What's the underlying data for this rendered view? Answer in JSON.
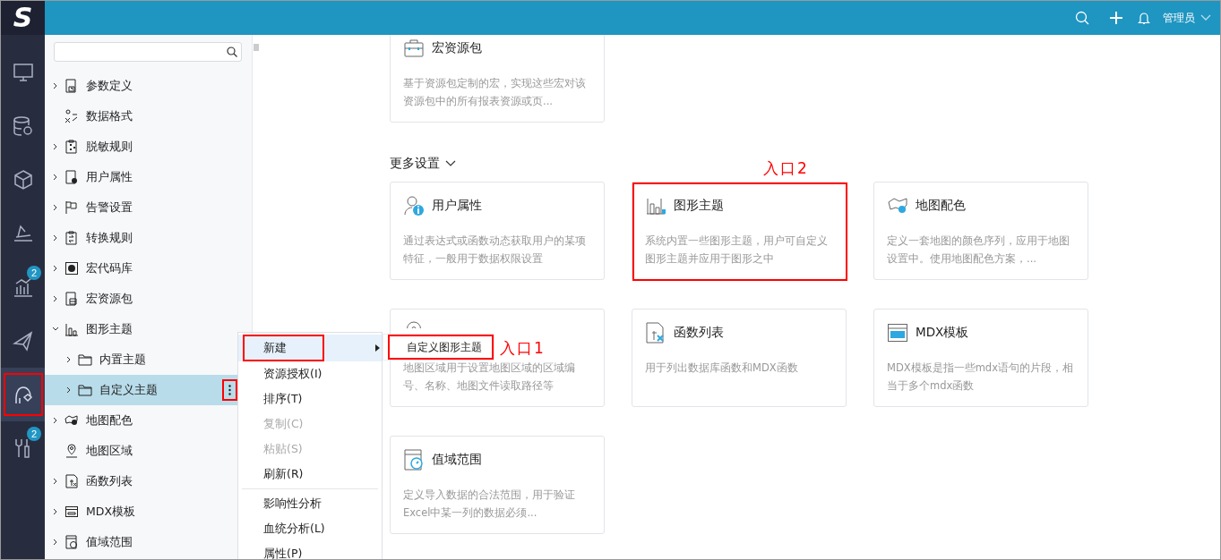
{
  "logo": "S",
  "header": {
    "user": "管理员"
  },
  "rail": [
    {
      "kind": "monitor",
      "selected": false,
      "highlighted": false
    },
    {
      "kind": "database",
      "selected": false,
      "highlighted": false
    },
    {
      "kind": "cube",
      "selected": false,
      "highlighted": false
    },
    {
      "kind": "pen",
      "selected": false,
      "highlighted": false
    },
    {
      "kind": "chart",
      "selected": false,
      "highlighted": false,
      "badge": "2"
    },
    {
      "kind": "plane",
      "selected": false,
      "highlighted": false
    },
    {
      "kind": "theme",
      "selected": true,
      "highlighted": true
    },
    {
      "kind": "tools",
      "selected": false,
      "highlighted": false,
      "badge": "2"
    }
  ],
  "tree": {
    "items": [
      {
        "label": "参数定义",
        "kind": "param",
        "expandable": true,
        "expanded": false,
        "selected": false
      },
      {
        "label": "数据格式",
        "kind": "format",
        "expandable": false,
        "selected": false
      },
      {
        "label": "脱敏规则",
        "kind": "mask",
        "expandable": true,
        "expanded": false,
        "selected": false
      },
      {
        "label": "用户属性",
        "kind": "user",
        "expandable": true,
        "expanded": false,
        "selected": false
      },
      {
        "label": "告警设置",
        "kind": "alert",
        "expandable": true,
        "expanded": false,
        "selected": false
      },
      {
        "label": "转换规则",
        "kind": "convert",
        "expandable": true,
        "expanded": false,
        "selected": false
      },
      {
        "label": "宏代码库",
        "kind": "macro",
        "expandable": true,
        "expanded": false,
        "selected": false
      },
      {
        "label": "宏资源包",
        "kind": "package",
        "expandable": true,
        "expanded": false,
        "selected": false
      },
      {
        "label": "图形主题",
        "kind": "chart",
        "expandable": true,
        "expanded": true,
        "selected": false,
        "children": [
          {
            "label": "内置主题",
            "kind": "folder",
            "expandable": true,
            "expanded": false,
            "selected": false
          },
          {
            "label": "自定义主题",
            "kind": "folder",
            "expandable": true,
            "expanded": false,
            "selected": true,
            "more_highlighted": true
          }
        ]
      },
      {
        "label": "地图配色",
        "kind": "mapcolor",
        "expandable": true,
        "expanded": false,
        "selected": false
      },
      {
        "label": "地图区域",
        "kind": "pin",
        "expandable": false,
        "selected": false
      },
      {
        "label": "函数列表",
        "kind": "fx",
        "expandable": true,
        "expanded": false,
        "selected": false
      },
      {
        "label": "MDX模板",
        "kind": "mdx",
        "expandable": true,
        "expanded": false,
        "selected": false
      },
      {
        "label": "值域范围",
        "kind": "range",
        "expandable": true,
        "expanded": false,
        "selected": false
      }
    ]
  },
  "context_menu": {
    "items": [
      {
        "kind": "item",
        "label": "新建",
        "disabled": false,
        "selected": true,
        "highlighted": true,
        "submenu": true
      },
      {
        "kind": "item",
        "label": "资源授权(I)",
        "disabled": false,
        "selected": false,
        "highlighted": false,
        "submenu": false
      },
      {
        "kind": "item",
        "label": "排序(T)",
        "disabled": false,
        "selected": false,
        "highlighted": false,
        "submenu": false
      },
      {
        "kind": "item",
        "label": "复制(C)",
        "disabled": true,
        "selected": false,
        "highlighted": false,
        "submenu": false
      },
      {
        "kind": "item",
        "label": "粘贴(S)",
        "disabled": true,
        "selected": false,
        "highlighted": false,
        "submenu": false
      },
      {
        "kind": "item",
        "label": "刷新(R)",
        "disabled": false,
        "selected": false,
        "highlighted": false,
        "submenu": false
      },
      {
        "kind": "divider"
      },
      {
        "kind": "item",
        "label": "影响性分析",
        "disabled": false,
        "selected": false,
        "highlighted": false,
        "submenu": false
      },
      {
        "kind": "item",
        "label": "血统分析(L)",
        "disabled": false,
        "selected": false,
        "highlighted": false,
        "submenu": false
      },
      {
        "kind": "item",
        "label": "属性(P)",
        "disabled": false,
        "selected": false,
        "highlighted": false,
        "submenu": false
      }
    ],
    "submenu": [
      {
        "label": "自定义图形主题",
        "highlighted": true,
        "callout": "入口1"
      }
    ]
  },
  "content": {
    "top_card": {
      "kind": "package",
      "title": "宏资源包",
      "description": "基于资源包定制的宏，实现这些宏对该资源包中的所有报表资源或页...",
      "highlighted": false
    },
    "section": {
      "title": "更多设置",
      "expanded": true
    },
    "cards": [
      {
        "kind": "user",
        "title": "用户属性",
        "description": "通过表达式或函数动态获取用户的某项特征，一般用于数据权限设置",
        "highlighted": false
      },
      {
        "kind": "chart",
        "title": "图形主题",
        "description": "系统内置一些图形主题，用户可自定义图形主题并应用于图形之中",
        "highlighted": true,
        "callout": "入口2"
      },
      {
        "kind": "mapcolor",
        "title": "地图配色",
        "description": "定义一套地图的颜色序列，应用于地图设置中。使用地图配色方案，...",
        "highlighted": false
      },
      {
        "kind": "pin",
        "description": "地图区域用于设置地图区域的区域编号、名称、地图文件读取路径等",
        "highlighted": false
      },
      {
        "kind": "fx",
        "title": "函数列表",
        "description": "用于列出数据库函数和MDX函数",
        "highlighted": false
      },
      {
        "kind": "mdx",
        "title": "MDX模板",
        "description": "MDX模板是指一些mdx语句的片段，相当于多个mdx函数",
        "highlighted": false
      },
      {
        "kind": "range",
        "title": "值域范围",
        "description": "定义导入数据的合法范围，用于验证Excel中某一列的数据必须...",
        "highlighted": false
      }
    ]
  }
}
